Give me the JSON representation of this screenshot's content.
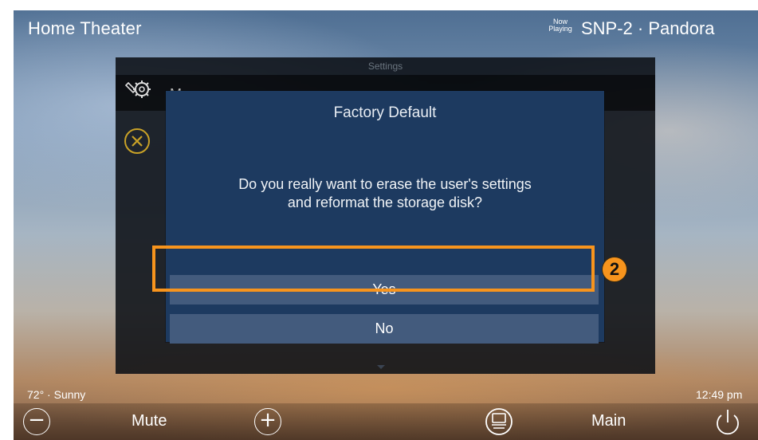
{
  "top_bar": {
    "title": "Home Theater",
    "now_playing_line1": "Now",
    "now_playing_line2": "Playing",
    "source": "SNP-2 · Pandora"
  },
  "settings_panel": {
    "title": "Settings",
    "menu_label": "Menu",
    "icons": [
      "wrench-gear-icon",
      "close-icon"
    ]
  },
  "dialog": {
    "title": "Factory Default",
    "message_line1": "Do you really want to erase the user's settings",
    "message_line2": "and reformat the storage disk?",
    "yes_label": "Yes",
    "no_label": "No"
  },
  "annotation": {
    "step_number": "2",
    "color": "#f7941d"
  },
  "status": {
    "weather": "72° · Sunny",
    "time": "12:49 pm"
  },
  "bottom_bar": {
    "mute_label": "Mute",
    "main_label": "Main",
    "volume_down_glyph": "−",
    "volume_up_glyph": "+",
    "icons": [
      "volume-down-icon",
      "volume-up-icon",
      "source-select-icon",
      "power-icon"
    ]
  },
  "colors": {
    "dialog_bg": "#1d3a60",
    "button_bg": "#435b7d",
    "panel_bg": "#0c1016"
  }
}
